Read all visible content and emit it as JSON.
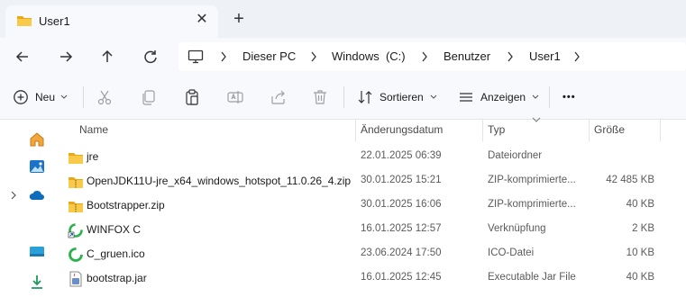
{
  "tab": {
    "title": "User1"
  },
  "breadcrumb": [
    "Dieser PC",
    "Windows  (C:)",
    "Benutzer",
    "User1"
  ],
  "toolbar": {
    "new_label": "Neu",
    "sort_label": "Sortieren",
    "view_label": "Anzeigen",
    "more_label": "•••"
  },
  "columns": {
    "name": "Name",
    "date": "Änderungsdatum",
    "type": "Typ",
    "size": "Größe"
  },
  "files": [
    {
      "name": "jre",
      "date": "22.01.2025 06:39",
      "type": "Dateiordner",
      "size": "",
      "icon": "folder-icon"
    },
    {
      "name": "OpenJDK11U-jre_x64_windows_hotspot_11.0.26_4.zip",
      "date": "30.01.2025 15:21",
      "type": "ZIP-komprimierte...",
      "size": "42 485 KB",
      "icon": "zip-folder-icon"
    },
    {
      "name": "Bootstrapper.zip",
      "date": "30.01.2025 16:06",
      "type": "ZIP-komprimierte...",
      "size": "40 KB",
      "icon": "zip-folder-icon"
    },
    {
      "name": "WINFOX C",
      "date": "16.01.2025 12:57",
      "type": "Verknüpfung",
      "size": "2 KB",
      "icon": "shortcut-icon"
    },
    {
      "name": "C_gruen.ico",
      "date": "23.06.2024 17:50",
      "type": "ICO-Datei",
      "size": "10 KB",
      "icon": "ico-file-icon"
    },
    {
      "name": "bootstrap.jar",
      "date": "16.01.2025 12:45",
      "type": "Executable Jar File",
      "size": "40 KB",
      "icon": "jar-file-icon"
    }
  ],
  "colors": {
    "accent": "#0067c0",
    "folder": "#f5c24c",
    "green": "#2bb24c"
  }
}
